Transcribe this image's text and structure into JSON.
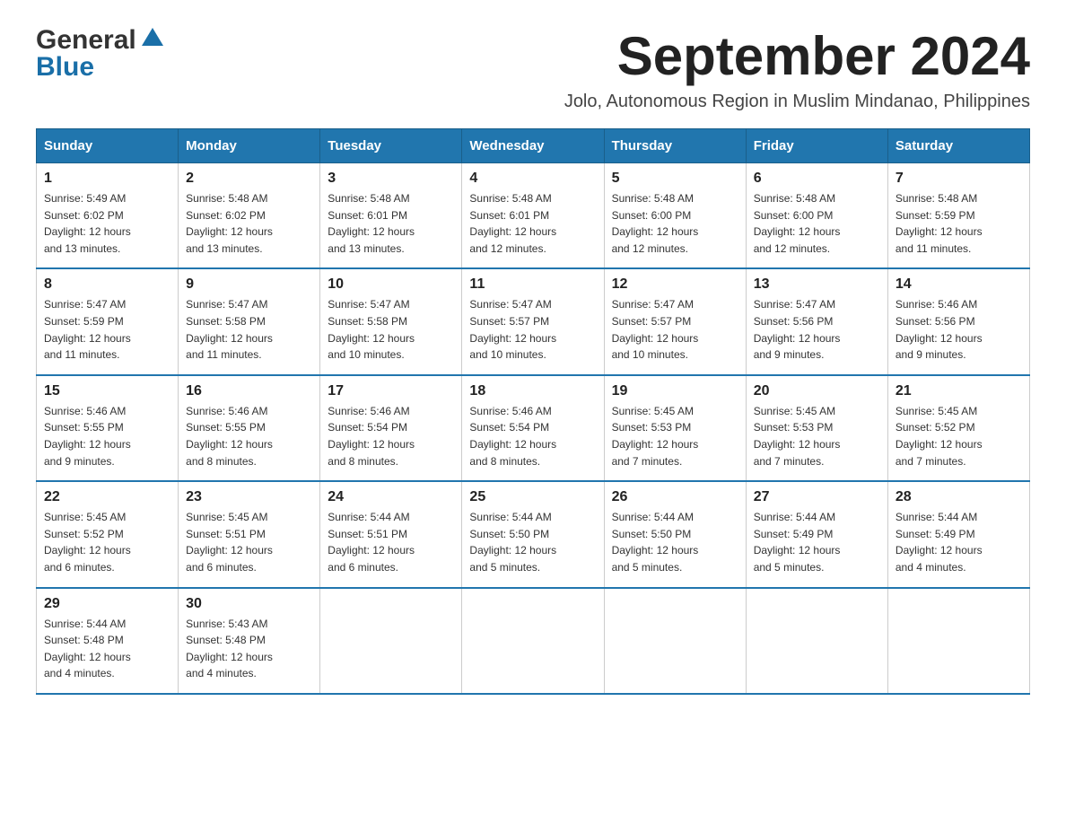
{
  "logo": {
    "general": "General",
    "blue": "Blue"
  },
  "header": {
    "month_year": "September 2024",
    "subtitle": "Jolo, Autonomous Region in Muslim Mindanao, Philippines"
  },
  "weekdays": [
    "Sunday",
    "Monday",
    "Tuesday",
    "Wednesday",
    "Thursday",
    "Friday",
    "Saturday"
  ],
  "weeks": [
    [
      {
        "day": "1",
        "sunrise": "5:49 AM",
        "sunset": "6:02 PM",
        "daylight": "12 hours and 13 minutes."
      },
      {
        "day": "2",
        "sunrise": "5:48 AM",
        "sunset": "6:02 PM",
        "daylight": "12 hours and 13 minutes."
      },
      {
        "day": "3",
        "sunrise": "5:48 AM",
        "sunset": "6:01 PM",
        "daylight": "12 hours and 13 minutes."
      },
      {
        "day": "4",
        "sunrise": "5:48 AM",
        "sunset": "6:01 PM",
        "daylight": "12 hours and 12 minutes."
      },
      {
        "day": "5",
        "sunrise": "5:48 AM",
        "sunset": "6:00 PM",
        "daylight": "12 hours and 12 minutes."
      },
      {
        "day": "6",
        "sunrise": "5:48 AM",
        "sunset": "6:00 PM",
        "daylight": "12 hours and 12 minutes."
      },
      {
        "day": "7",
        "sunrise": "5:48 AM",
        "sunset": "5:59 PM",
        "daylight": "12 hours and 11 minutes."
      }
    ],
    [
      {
        "day": "8",
        "sunrise": "5:47 AM",
        "sunset": "5:59 PM",
        "daylight": "12 hours and 11 minutes."
      },
      {
        "day": "9",
        "sunrise": "5:47 AM",
        "sunset": "5:58 PM",
        "daylight": "12 hours and 11 minutes."
      },
      {
        "day": "10",
        "sunrise": "5:47 AM",
        "sunset": "5:58 PM",
        "daylight": "12 hours and 10 minutes."
      },
      {
        "day": "11",
        "sunrise": "5:47 AM",
        "sunset": "5:57 PM",
        "daylight": "12 hours and 10 minutes."
      },
      {
        "day": "12",
        "sunrise": "5:47 AM",
        "sunset": "5:57 PM",
        "daylight": "12 hours and 10 minutes."
      },
      {
        "day": "13",
        "sunrise": "5:47 AM",
        "sunset": "5:56 PM",
        "daylight": "12 hours and 9 minutes."
      },
      {
        "day": "14",
        "sunrise": "5:46 AM",
        "sunset": "5:56 PM",
        "daylight": "12 hours and 9 minutes."
      }
    ],
    [
      {
        "day": "15",
        "sunrise": "5:46 AM",
        "sunset": "5:55 PM",
        "daylight": "12 hours and 9 minutes."
      },
      {
        "day": "16",
        "sunrise": "5:46 AM",
        "sunset": "5:55 PM",
        "daylight": "12 hours and 8 minutes."
      },
      {
        "day": "17",
        "sunrise": "5:46 AM",
        "sunset": "5:54 PM",
        "daylight": "12 hours and 8 minutes."
      },
      {
        "day": "18",
        "sunrise": "5:46 AM",
        "sunset": "5:54 PM",
        "daylight": "12 hours and 8 minutes."
      },
      {
        "day": "19",
        "sunrise": "5:45 AM",
        "sunset": "5:53 PM",
        "daylight": "12 hours and 7 minutes."
      },
      {
        "day": "20",
        "sunrise": "5:45 AM",
        "sunset": "5:53 PM",
        "daylight": "12 hours and 7 minutes."
      },
      {
        "day": "21",
        "sunrise": "5:45 AM",
        "sunset": "5:52 PM",
        "daylight": "12 hours and 7 minutes."
      }
    ],
    [
      {
        "day": "22",
        "sunrise": "5:45 AM",
        "sunset": "5:52 PM",
        "daylight": "12 hours and 6 minutes."
      },
      {
        "day": "23",
        "sunrise": "5:45 AM",
        "sunset": "5:51 PM",
        "daylight": "12 hours and 6 minutes."
      },
      {
        "day": "24",
        "sunrise": "5:44 AM",
        "sunset": "5:51 PM",
        "daylight": "12 hours and 6 minutes."
      },
      {
        "day": "25",
        "sunrise": "5:44 AM",
        "sunset": "5:50 PM",
        "daylight": "12 hours and 5 minutes."
      },
      {
        "day": "26",
        "sunrise": "5:44 AM",
        "sunset": "5:50 PM",
        "daylight": "12 hours and 5 minutes."
      },
      {
        "day": "27",
        "sunrise": "5:44 AM",
        "sunset": "5:49 PM",
        "daylight": "12 hours and 5 minutes."
      },
      {
        "day": "28",
        "sunrise": "5:44 AM",
        "sunset": "5:49 PM",
        "daylight": "12 hours and 4 minutes."
      }
    ],
    [
      {
        "day": "29",
        "sunrise": "5:44 AM",
        "sunset": "5:48 PM",
        "daylight": "12 hours and 4 minutes."
      },
      {
        "day": "30",
        "sunrise": "5:43 AM",
        "sunset": "5:48 PM",
        "daylight": "12 hours and 4 minutes."
      },
      null,
      null,
      null,
      null,
      null
    ]
  ]
}
